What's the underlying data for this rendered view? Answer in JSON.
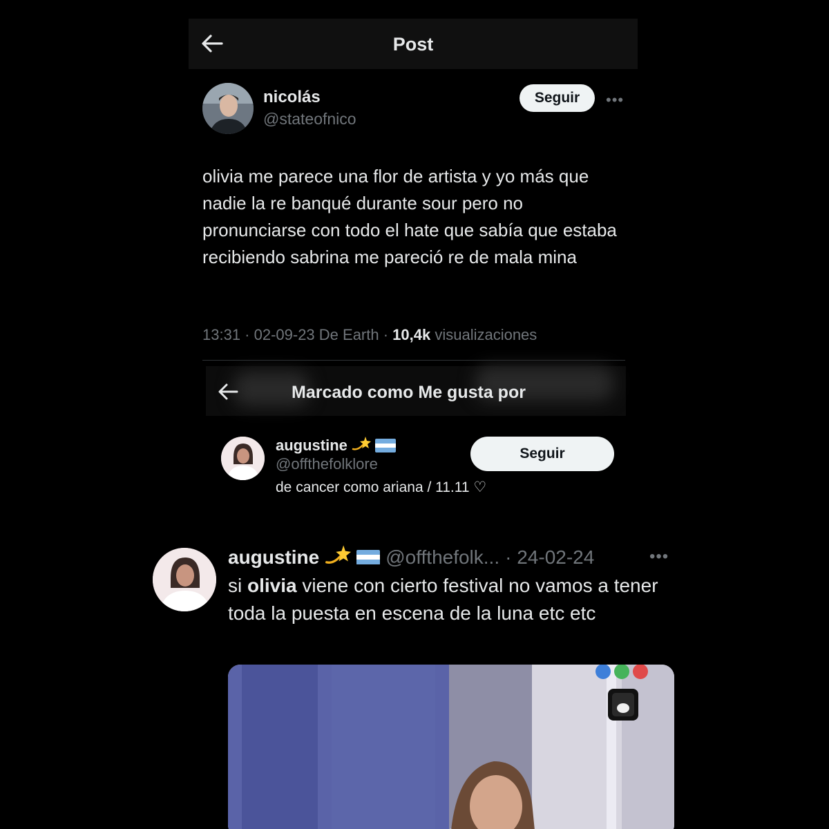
{
  "header": {
    "title": "Post"
  },
  "post": {
    "author_name": "nicolás",
    "author_handle": "@stateofnico",
    "follow_label": "Seguir",
    "more_label": "•••",
    "text": "olivia me parece una flor de artista y yo más que nadie la re banqué durante sour pero no pronunciarse con todo el hate que sabía que estaba recibiendo sabrina me pareció re de mala mina",
    "time": "13:31 · 02-09-23 De Earth · ",
    "views_count": "10,4k",
    "views_label": " visualizaciones"
  },
  "liked_by": {
    "title": "Marcado como Me gusta por",
    "user": {
      "name": "augustine",
      "handle": "@offthefolklore",
      "bio": "de cancer como ariana / 11.11 ♡",
      "follow_label": "Seguir"
    }
  },
  "quoted_tweet": {
    "name": "augustine",
    "handle": "@offthefolk...",
    "date": "· 24-02-24",
    "more_label": "•••",
    "text_prefix": "si ",
    "text_bold": "olivia",
    "text_suffix": " viene con cierto festival no vamos a tener toda la puesta en escena de la luna etc etc"
  },
  "icons": {
    "back": "back-arrow-icon",
    "sparkle": "dizzy-star-emoji",
    "flag": "argentina-flag-emoji"
  },
  "colors": {
    "background": "#000000",
    "text": "#e7e9ea",
    "muted": "#71767b",
    "button_bg": "#eff3f4",
    "flag_blue": "#74acdf"
  }
}
